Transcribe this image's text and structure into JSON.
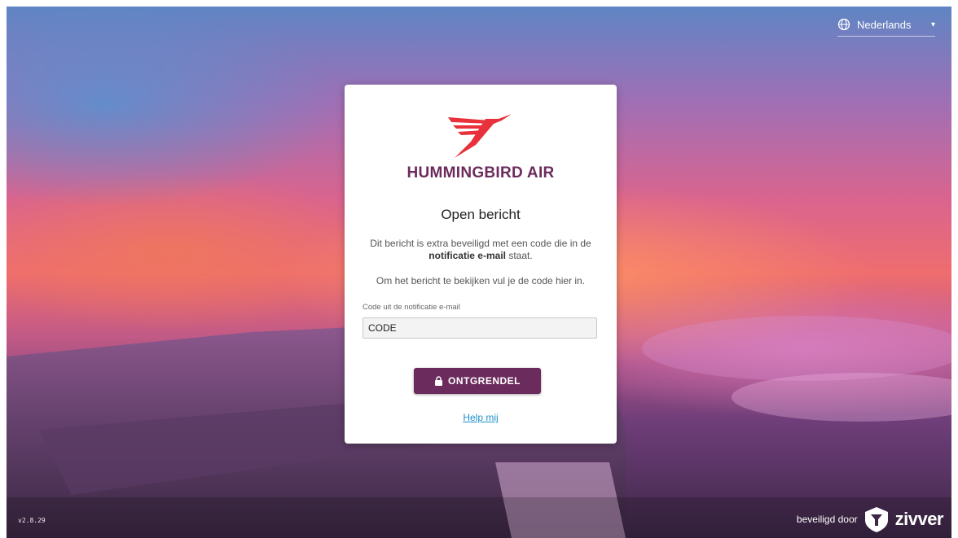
{
  "language": {
    "icon": "globe-icon",
    "selected": "Nederlands",
    "caret": "▾"
  },
  "brand": {
    "name": "HUMMINGBIRD AIR",
    "color": "#6b2c5d",
    "logo_color": "#e8313a"
  },
  "card": {
    "title": "Open bericht",
    "description_pre": "Dit bericht is extra beveiligd met een code die in de",
    "description_bold": "notificatie e-mail",
    "description_post": "staat.",
    "instruction": "Om het bericht te bekijken vul je de code hier in.",
    "field_label": "Code uit de notificatie e-mail",
    "field_placeholder": "CODE",
    "field_value": "",
    "unlock_button": "ONTGRENDEL",
    "unlock_icon": "lock-icon",
    "help_link": "Help mij"
  },
  "footer": {
    "version": "v2.8.29",
    "secured_by": "beveiligd door",
    "provider": "zivver"
  }
}
